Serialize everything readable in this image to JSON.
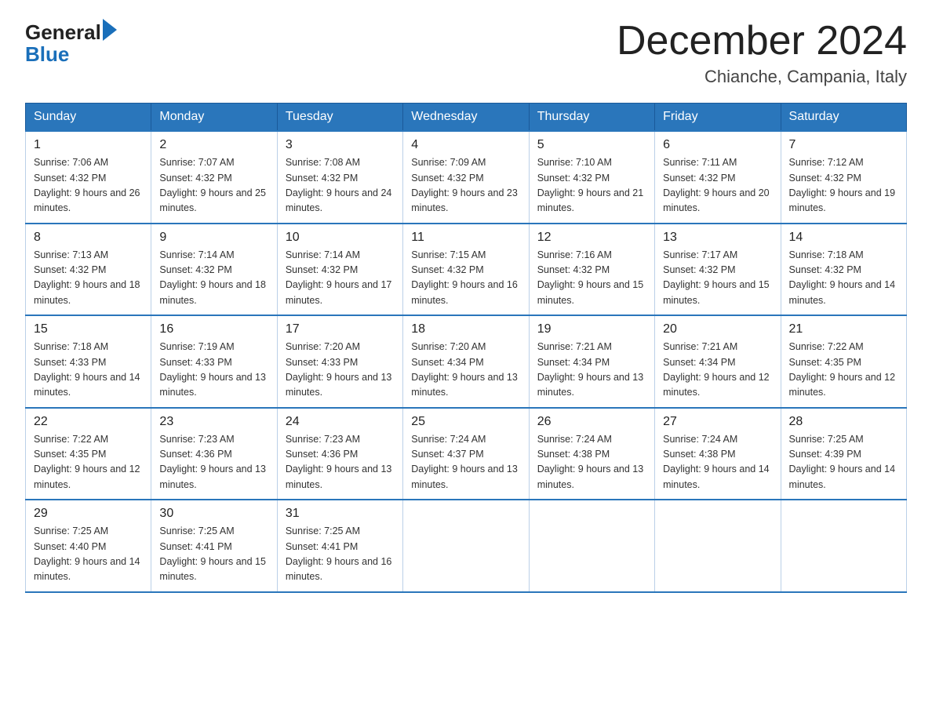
{
  "logo": {
    "general": "General",
    "blue": "Blue"
  },
  "header": {
    "month": "December 2024",
    "location": "Chianche, Campania, Italy"
  },
  "days_of_week": [
    "Sunday",
    "Monday",
    "Tuesday",
    "Wednesday",
    "Thursday",
    "Friday",
    "Saturday"
  ],
  "weeks": [
    [
      {
        "num": "1",
        "sunrise": "7:06 AM",
        "sunset": "4:32 PM",
        "daylight": "9 hours and 26 minutes."
      },
      {
        "num": "2",
        "sunrise": "7:07 AM",
        "sunset": "4:32 PM",
        "daylight": "9 hours and 25 minutes."
      },
      {
        "num": "3",
        "sunrise": "7:08 AM",
        "sunset": "4:32 PM",
        "daylight": "9 hours and 24 minutes."
      },
      {
        "num": "4",
        "sunrise": "7:09 AM",
        "sunset": "4:32 PM",
        "daylight": "9 hours and 23 minutes."
      },
      {
        "num": "5",
        "sunrise": "7:10 AM",
        "sunset": "4:32 PM",
        "daylight": "9 hours and 21 minutes."
      },
      {
        "num": "6",
        "sunrise": "7:11 AM",
        "sunset": "4:32 PM",
        "daylight": "9 hours and 20 minutes."
      },
      {
        "num": "7",
        "sunrise": "7:12 AM",
        "sunset": "4:32 PM",
        "daylight": "9 hours and 19 minutes."
      }
    ],
    [
      {
        "num": "8",
        "sunrise": "7:13 AM",
        "sunset": "4:32 PM",
        "daylight": "9 hours and 18 minutes."
      },
      {
        "num": "9",
        "sunrise": "7:14 AM",
        "sunset": "4:32 PM",
        "daylight": "9 hours and 18 minutes."
      },
      {
        "num": "10",
        "sunrise": "7:14 AM",
        "sunset": "4:32 PM",
        "daylight": "9 hours and 17 minutes."
      },
      {
        "num": "11",
        "sunrise": "7:15 AM",
        "sunset": "4:32 PM",
        "daylight": "9 hours and 16 minutes."
      },
      {
        "num": "12",
        "sunrise": "7:16 AM",
        "sunset": "4:32 PM",
        "daylight": "9 hours and 15 minutes."
      },
      {
        "num": "13",
        "sunrise": "7:17 AM",
        "sunset": "4:32 PM",
        "daylight": "9 hours and 15 minutes."
      },
      {
        "num": "14",
        "sunrise": "7:18 AM",
        "sunset": "4:32 PM",
        "daylight": "9 hours and 14 minutes."
      }
    ],
    [
      {
        "num": "15",
        "sunrise": "7:18 AM",
        "sunset": "4:33 PM",
        "daylight": "9 hours and 14 minutes."
      },
      {
        "num": "16",
        "sunrise": "7:19 AM",
        "sunset": "4:33 PM",
        "daylight": "9 hours and 13 minutes."
      },
      {
        "num": "17",
        "sunrise": "7:20 AM",
        "sunset": "4:33 PM",
        "daylight": "9 hours and 13 minutes."
      },
      {
        "num": "18",
        "sunrise": "7:20 AM",
        "sunset": "4:34 PM",
        "daylight": "9 hours and 13 minutes."
      },
      {
        "num": "19",
        "sunrise": "7:21 AM",
        "sunset": "4:34 PM",
        "daylight": "9 hours and 13 minutes."
      },
      {
        "num": "20",
        "sunrise": "7:21 AM",
        "sunset": "4:34 PM",
        "daylight": "9 hours and 12 minutes."
      },
      {
        "num": "21",
        "sunrise": "7:22 AM",
        "sunset": "4:35 PM",
        "daylight": "9 hours and 12 minutes."
      }
    ],
    [
      {
        "num": "22",
        "sunrise": "7:22 AM",
        "sunset": "4:35 PM",
        "daylight": "9 hours and 12 minutes."
      },
      {
        "num": "23",
        "sunrise": "7:23 AM",
        "sunset": "4:36 PM",
        "daylight": "9 hours and 13 minutes."
      },
      {
        "num": "24",
        "sunrise": "7:23 AM",
        "sunset": "4:36 PM",
        "daylight": "9 hours and 13 minutes."
      },
      {
        "num": "25",
        "sunrise": "7:24 AM",
        "sunset": "4:37 PM",
        "daylight": "9 hours and 13 minutes."
      },
      {
        "num": "26",
        "sunrise": "7:24 AM",
        "sunset": "4:38 PM",
        "daylight": "9 hours and 13 minutes."
      },
      {
        "num": "27",
        "sunrise": "7:24 AM",
        "sunset": "4:38 PM",
        "daylight": "9 hours and 14 minutes."
      },
      {
        "num": "28",
        "sunrise": "7:25 AM",
        "sunset": "4:39 PM",
        "daylight": "9 hours and 14 minutes."
      }
    ],
    [
      {
        "num": "29",
        "sunrise": "7:25 AM",
        "sunset": "4:40 PM",
        "daylight": "9 hours and 14 minutes."
      },
      {
        "num": "30",
        "sunrise": "7:25 AM",
        "sunset": "4:41 PM",
        "daylight": "9 hours and 15 minutes."
      },
      {
        "num": "31",
        "sunrise": "7:25 AM",
        "sunset": "4:41 PM",
        "daylight": "9 hours and 16 minutes."
      },
      null,
      null,
      null,
      null
    ]
  ]
}
